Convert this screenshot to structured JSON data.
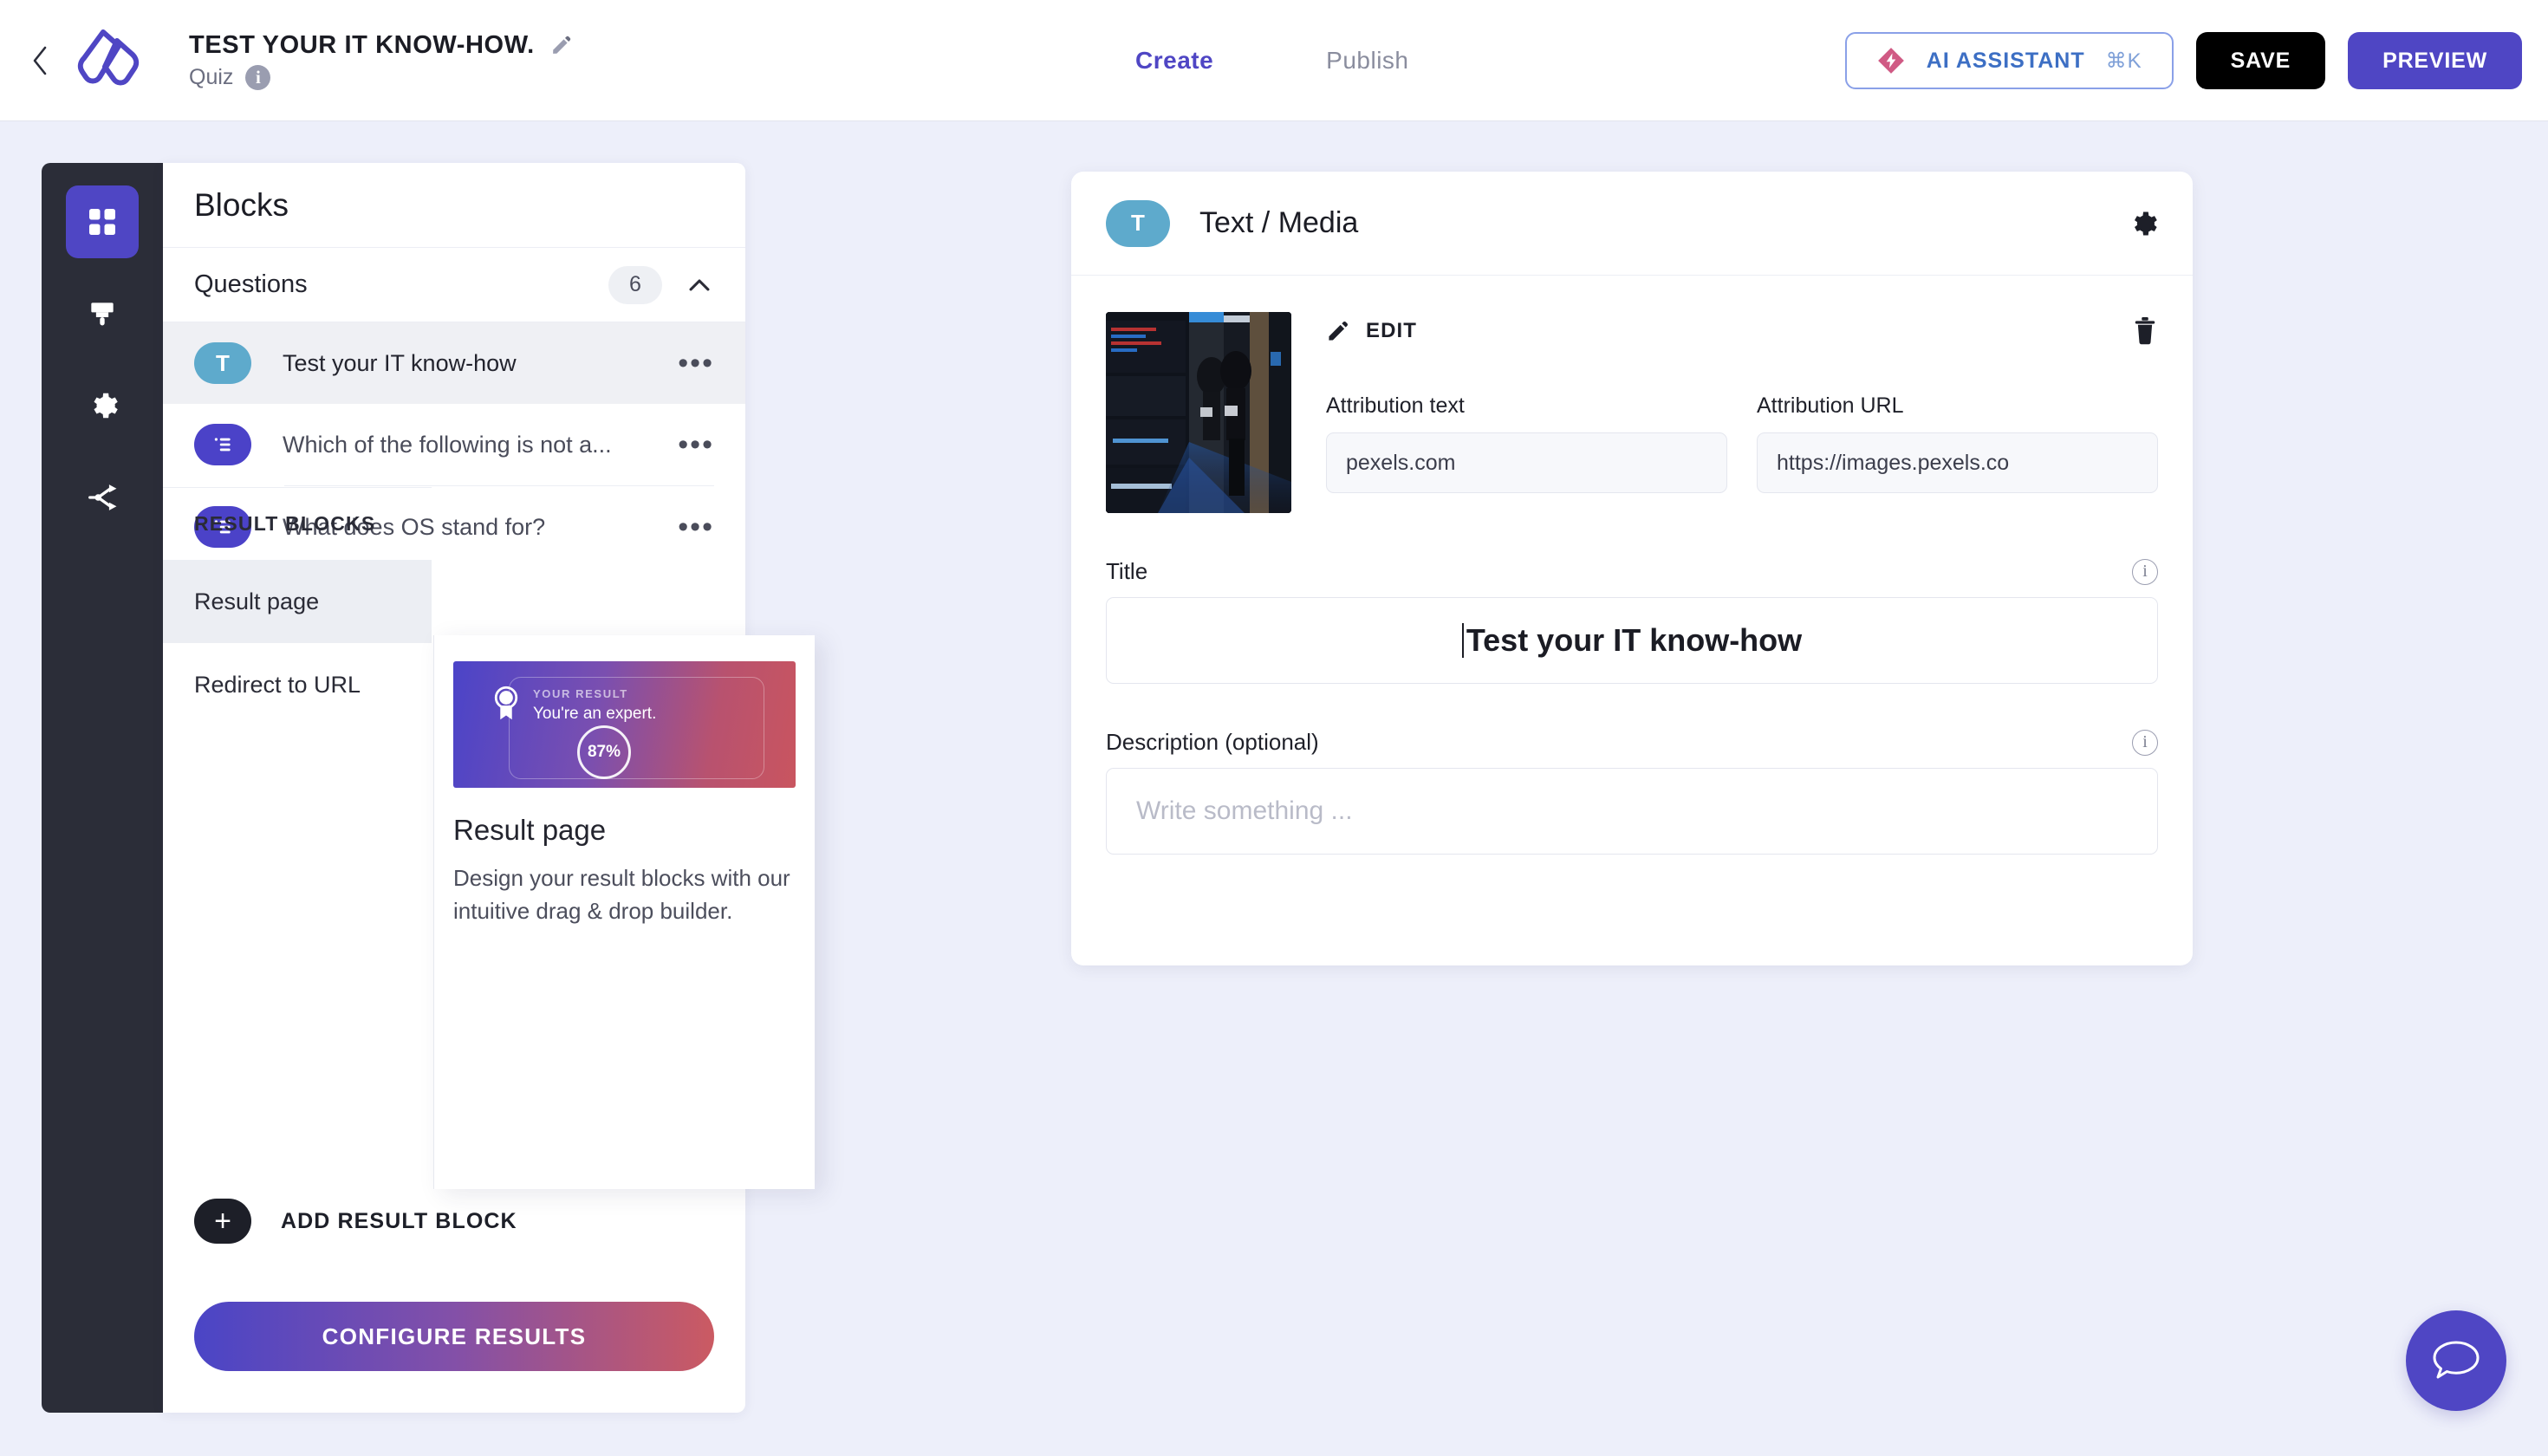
{
  "header": {
    "back_icon": "chevron-left-icon",
    "logo_icon": "brand-logo-icon",
    "app_title": "TEST YOUR IT KNOW-HOW.",
    "edit_title_icon": "pencil-icon",
    "subtitle": "Quiz",
    "subtitle_info_icon": "info-icon",
    "subtitle_info_glyph": "i",
    "tabs": [
      {
        "label": "Create",
        "active": true
      },
      {
        "label": "Publish",
        "active": false
      }
    ],
    "ai_button": {
      "icon": "ai-diamond-icon",
      "label": "AI ASSISTANT",
      "shortcut": "⌘K"
    },
    "save_label": "SAVE",
    "preview_label": "PREVIEW",
    "accent_color": "#4f46c4",
    "ai_text_color": "#3d6fc4",
    "ai_icon_color": "#d05a84"
  },
  "rail": {
    "items": [
      {
        "icon": "grid-blocks-icon",
        "name": "blocks",
        "active": true
      },
      {
        "icon": "paintbrush-icon",
        "name": "design",
        "active": false
      },
      {
        "icon": "gear-icon",
        "name": "settings",
        "active": false
      },
      {
        "icon": "share-nodes-icon",
        "name": "logic",
        "active": false
      }
    ],
    "background": "#2b2d38"
  },
  "blocks_panel": {
    "title": "Blocks",
    "questions_section": {
      "label": "Questions",
      "count": "6",
      "collapse_icon": "chevron-up-icon",
      "items": [
        {
          "badge": "T",
          "badge_type": "text",
          "label": "Test your IT know-how",
          "selected": true,
          "menu": "•••"
        },
        {
          "badge": "list",
          "badge_type": "choice",
          "label": "Which of the following is not a...",
          "selected": false,
          "menu": "•••"
        },
        {
          "badge": "list",
          "badge_type": "choice",
          "label": "What does OS stand for?",
          "selected": false,
          "menu": "•••"
        }
      ]
    },
    "result_blocks_section": {
      "label": "RESULT BLOCKS",
      "items": [
        {
          "label": "Result page",
          "selected": true
        },
        {
          "label": "Redirect to URL",
          "selected": false
        }
      ]
    },
    "add_result_block": {
      "plus_icon": "plus-icon",
      "plus_glyph": "+",
      "label": "ADD RESULT BLOCK"
    },
    "configure_results_label": "CONFIGURE RESULTS"
  },
  "preview_card": {
    "thumbnail": {
      "ribbon_icon": "award-ribbon-icon",
      "kicker": "YOUR RESULT",
      "headline": "You're an expert.",
      "score": "87%"
    },
    "title": "Result page",
    "description": "Design your result blocks with our intuitive drag & drop builder."
  },
  "editor": {
    "badge": "T",
    "title": "Text / Media",
    "settings_icon": "gear-icon",
    "media": {
      "image_alt": "server-room-photo",
      "edit_icon": "pencil-icon",
      "edit_label": "EDIT",
      "delete_icon": "trash-icon"
    },
    "attribution_text": {
      "label": "Attribution text",
      "value": "pexels.com"
    },
    "attribution_url": {
      "label": "Attribution URL",
      "value": "https://images.pexels.co"
    },
    "title_field": {
      "label": "Title",
      "info_icon": "info-icon",
      "info_glyph": "i",
      "value": "Test your IT know-how"
    },
    "description_field": {
      "label": "Description (optional)",
      "info_icon": "info-icon",
      "info_glyph": "i",
      "value": "",
      "placeholder": "Write something ..."
    }
  },
  "chat_fab": {
    "icon": "chat-bubble-icon",
    "color": "#4f46c4"
  }
}
